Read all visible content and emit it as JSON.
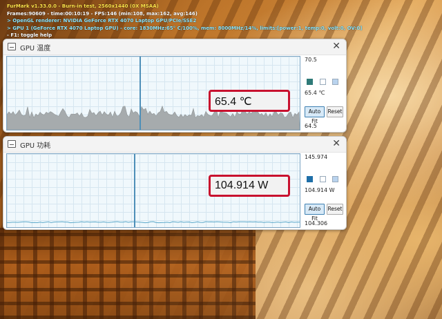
{
  "hud": {
    "line1": "FurMark v1.33.0.0 - Burn-in test, 2560x1440 (0X MSAA)",
    "line2": "Frames:90609 - time:00:10:19 - FPS:146 (min:108, max:162, avg:146)",
    "line3": "> OpenGL renderer: NVIDIA GeForce RTX 4070 Laptop GPU/PCIe/SSE2",
    "line4": "> GPU 1 (GeForce RTX 4070 Laptop GPU) - core: 1830MHz:65° C/100%, mem: 8000MHz/14%, limits:[power:1, temp:0, volt:0, OV:0]",
    "line5": "- F1: toggle help"
  },
  "temp_window": {
    "title": "GPU 温度",
    "readout": "65.4 ℃",
    "max_label": "70.5",
    "current_label": "65.4 ℃",
    "min_label": "64.5",
    "autofit": "Auto Fit",
    "reset": "Reset",
    "level": 0.38
  },
  "power_window": {
    "title": "GPU 功耗",
    "readout": "104.914 W",
    "max_label": "145.974",
    "current_label": "104.914 W",
    "min_label": "104.306",
    "autofit": "Auto Fit",
    "reset": "Reset",
    "level": 0.03
  },
  "colors": {
    "plot_fill": "#a6abad",
    "power_line": "#5aa7c9",
    "accent": "#2c7fb5"
  }
}
